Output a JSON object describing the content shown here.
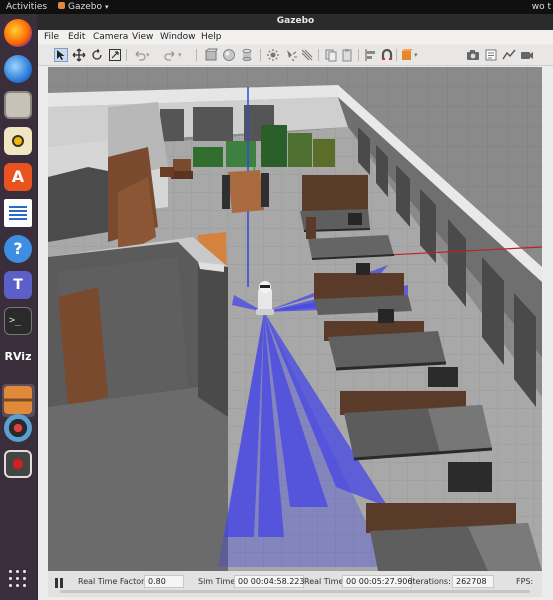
{
  "topbar": {
    "activities": "Activities",
    "app_name": "Gazebo",
    "clock": "",
    "right_partial": "wo t"
  },
  "dock": {
    "items": [
      {
        "name": "firefox-icon"
      },
      {
        "name": "thunderbird-icon"
      },
      {
        "name": "files-icon"
      },
      {
        "name": "rhythmbox-icon"
      },
      {
        "name": "software-center-icon"
      },
      {
        "name": "libreoffice-writer-icon"
      },
      {
        "name": "help-icon"
      },
      {
        "name": "teams-icon"
      },
      {
        "name": "terminal-icon"
      },
      {
        "name": "rviz-icon",
        "label": "RViz"
      },
      {
        "name": "gazebo-icon"
      },
      {
        "name": "webcam-icon"
      },
      {
        "name": "screen-recorder-icon"
      }
    ]
  },
  "window": {
    "title": "Gazebo",
    "menu": [
      "File",
      "Edit",
      "Camera",
      "View",
      "Window",
      "Help"
    ]
  },
  "toolbar": {
    "icons": [
      "select-arrow-icon",
      "translate-icon",
      "rotate-icon",
      "scale-icon",
      "undo-icon",
      "redo-icon",
      "box-icon",
      "sphere-icon",
      "cylinder-icon",
      "point-light-icon",
      "spot-light-icon",
      "directional-light-icon",
      "copy-icon",
      "paste-icon",
      "align-icon",
      "snap-icon",
      "change-view-icon",
      "screenshot-icon",
      "log-icon",
      "plot-icon",
      "video-icon"
    ]
  },
  "status": {
    "rtf_label": "Real Time Factor:",
    "rtf_value": "0.80",
    "sim_label": "Sim Time:",
    "sim_value": "00 00:04:58.223",
    "real_label": "Real Time:",
    "real_value": "00 00:05:27.906",
    "iter_label": "Iterations:",
    "iter_value": "262708",
    "fps_label": "FPS:"
  },
  "colors": {
    "laser": "#4646e6",
    "floor": "#a9a9a9",
    "wall": "#d8d8d8",
    "bed_frame": "#5a3a28",
    "mattress": "#5e5e5e"
  }
}
